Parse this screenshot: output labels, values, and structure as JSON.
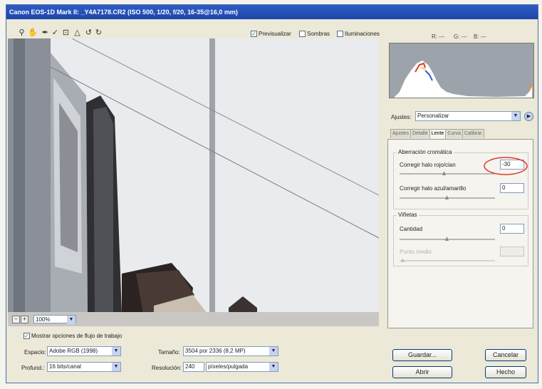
{
  "window": {
    "title": "Canon EOS-1D Mark II: _Y4A7178.CR2 (ISO 500, 1/20, f/20, 16-35@16,0 mm)"
  },
  "toolbar": {
    "tools": [
      "zoom-icon",
      "hand-icon",
      "white-balance-icon",
      "color-sampler-icon",
      "crop-icon",
      "straighten-icon",
      "rotate-left-icon",
      "rotate-right-icon"
    ],
    "preview_label": "Previsualizar",
    "preview_checked": "✓",
    "shadows_label": "Sombras",
    "highlights_label": "Iluminaciones"
  },
  "readout": {
    "r": "R: ---",
    "g": "G: ---",
    "b": "B: ---"
  },
  "zoom": {
    "minus": "−",
    "plus": "+",
    "value": "100%"
  },
  "workflow": {
    "checkbox_checked": "✓",
    "show_label": "Mostrar opciones de flujo de trabajo",
    "space_label": "Espacio:",
    "space_value": "Adobe RGB (1998)",
    "depth_label": "Profund.:",
    "depth_value": "16 bits/canal",
    "size_label": "Tamaño:",
    "size_value": "3504 por 2336 (8,2 MP)",
    "res_label": "Resolución:",
    "res_value": "240",
    "res_unit": "píxeles/pulgada"
  },
  "settings": {
    "label": "Ajustes:",
    "value": "Personalizar"
  },
  "tabs": [
    "Ajustes",
    "Detalle",
    "Lente",
    "Curva",
    "Calibrar"
  ],
  "lens": {
    "ca_group": "Aberración cromática",
    "rc_label": "Corregir halo rojo/cian",
    "rc_value": "-30",
    "by_label": "Corregir halo azul/amarillo",
    "by_value": "0",
    "vig_group": "Viñetas",
    "amount_label": "Cantidad",
    "amount_value": "0",
    "mid_label": "Punto medio",
    "mid_value": ""
  },
  "buttons": {
    "save": "Guardar...",
    "open": "Abrir",
    "cancel": "Cancelar",
    "done": "Hecho"
  },
  "colors": {
    "title_bar": "#1d46a8",
    "highlight_circle": "#e03a2f"
  }
}
